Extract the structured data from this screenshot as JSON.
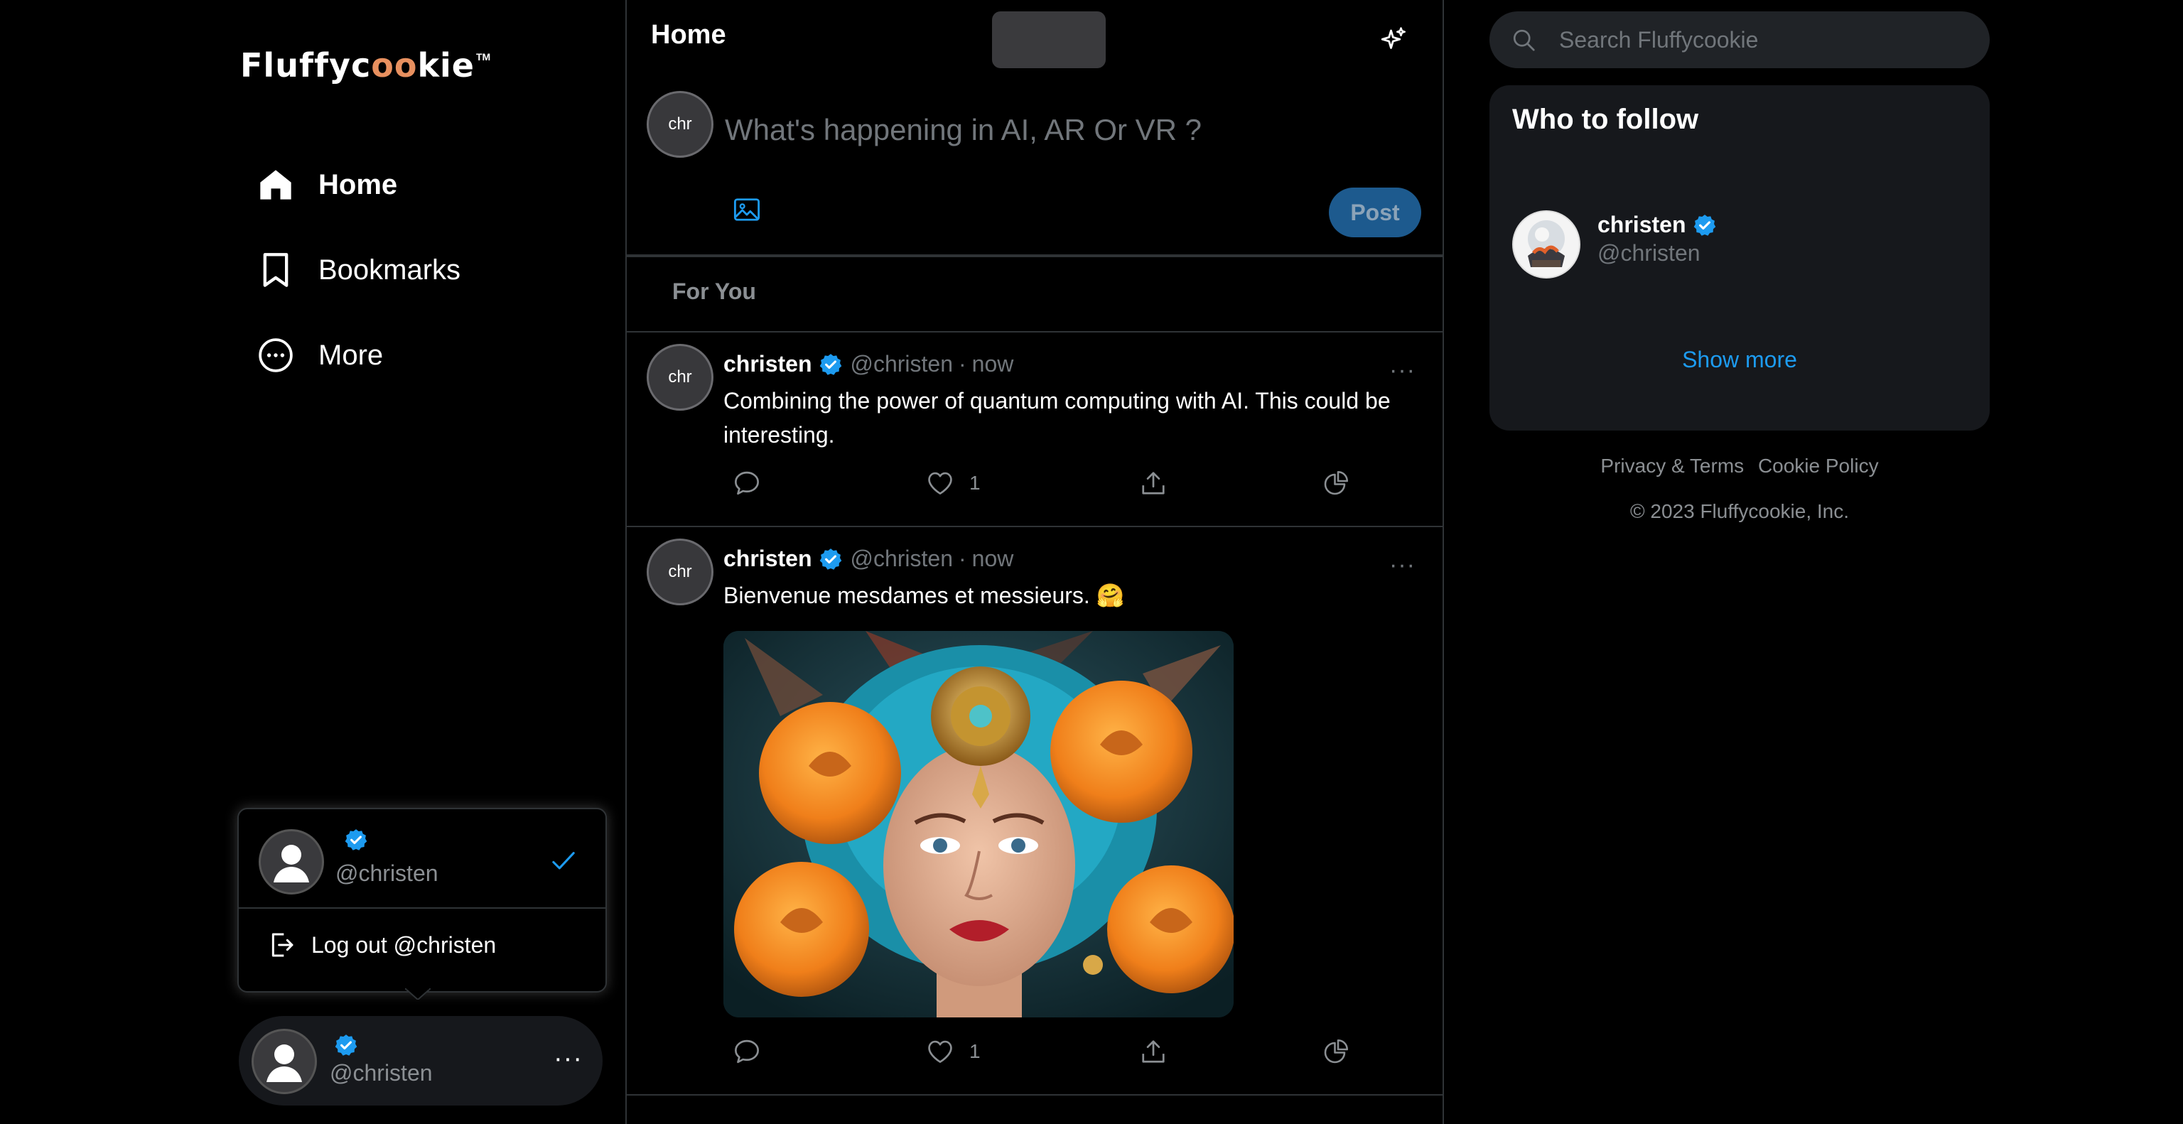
{
  "app": {
    "brand": "Fluffycookie",
    "brand_prefix": "Fluffyc",
    "brand_cookie": "oo",
    "brand_suffix": "kie",
    "brand_tm": "TM"
  },
  "sidebar": {
    "items": [
      {
        "label": "Home",
        "icon": "home-icon",
        "active": true
      },
      {
        "label": "Bookmarks",
        "icon": "bookmark-icon",
        "active": false
      },
      {
        "label": "More",
        "icon": "more-circle-icon",
        "active": false
      }
    ]
  },
  "account_menu": {
    "handle": "@christen",
    "logout_label": "Log out @christen"
  },
  "account_switcher": {
    "handle": "@christen",
    "more": "···"
  },
  "header": {
    "title": "Home"
  },
  "composer": {
    "avatar_text": "chr",
    "placeholder": "What's happening in AI, AR Or VR ?",
    "post_label": "Post"
  },
  "tabs": [
    {
      "label": "For You"
    }
  ],
  "tweets": [
    {
      "avatar_text": "chr",
      "name": "christen",
      "handle": "@christen",
      "dot": "·",
      "time": "now",
      "menu": "···",
      "text": "Combining the power of quantum computing with AI. This could be interesting.",
      "likes": "1",
      "has_image": false
    },
    {
      "avatar_text": "chr",
      "name": "christen",
      "handle": "@christen",
      "dot": "·",
      "time": "now",
      "menu": "···",
      "text": "Bienvenue mesdames et messieurs. 🤗",
      "likes": "1",
      "has_image": true
    }
  ],
  "right": {
    "search_placeholder": "Search Fluffycookie",
    "who_to_follow_title": "Who to follow",
    "suggestion": {
      "name": "christen",
      "handle": "@christen"
    },
    "show_more": "Show more",
    "footer_links": [
      "Privacy & Terms",
      "Cookie Policy"
    ],
    "copyright": "© 2023 Fluffycookie, Inc."
  },
  "colors": {
    "accent": "#1d9bf0",
    "post_button": "#1d5a8e",
    "background": "#000000",
    "card": "#16181c",
    "border": "#2f3336"
  }
}
